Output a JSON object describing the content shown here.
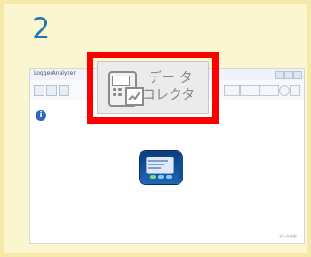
{
  "step": {
    "number": "2"
  },
  "app": {
    "title": "LoggerAnalyzer",
    "toolbar": {
      "data_collector_label_line1": "デー タ",
      "data_collector_label_line2": "コレクタ"
    },
    "status_text": "データ分析",
    "icons": [
      "data-collector-icon",
      "info-icon",
      "device-icon"
    ]
  },
  "colors": {
    "accent": "#1f78b4",
    "callout": "#ff0000",
    "background": "#fcf6d0"
  }
}
